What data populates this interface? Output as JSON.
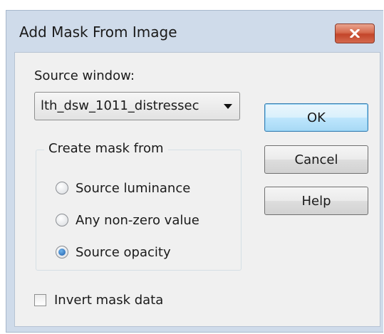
{
  "window": {
    "title": "Add Mask From Image"
  },
  "source": {
    "label": "Source window:",
    "selected_value": "lth_dsw_1011_distressec"
  },
  "mask_group": {
    "legend": "Create mask from",
    "options": [
      {
        "label": "Source luminance",
        "checked": false
      },
      {
        "label": "Any non-zero value",
        "checked": false
      },
      {
        "label": "Source opacity",
        "checked": true
      }
    ]
  },
  "invert": {
    "label": "Invert mask data",
    "checked": false
  },
  "buttons": {
    "ok": "OK",
    "cancel": "Cancel",
    "help": "Help"
  },
  "icons": {
    "close": "close-icon",
    "dropdown": "chevron-down-icon"
  },
  "colors": {
    "frame": "#cfdbea",
    "client": "#f0f0f0",
    "close_button": "#c94a2f",
    "default_button_border": "#3c7fb1",
    "radio_dot": "#1c5aa8"
  }
}
